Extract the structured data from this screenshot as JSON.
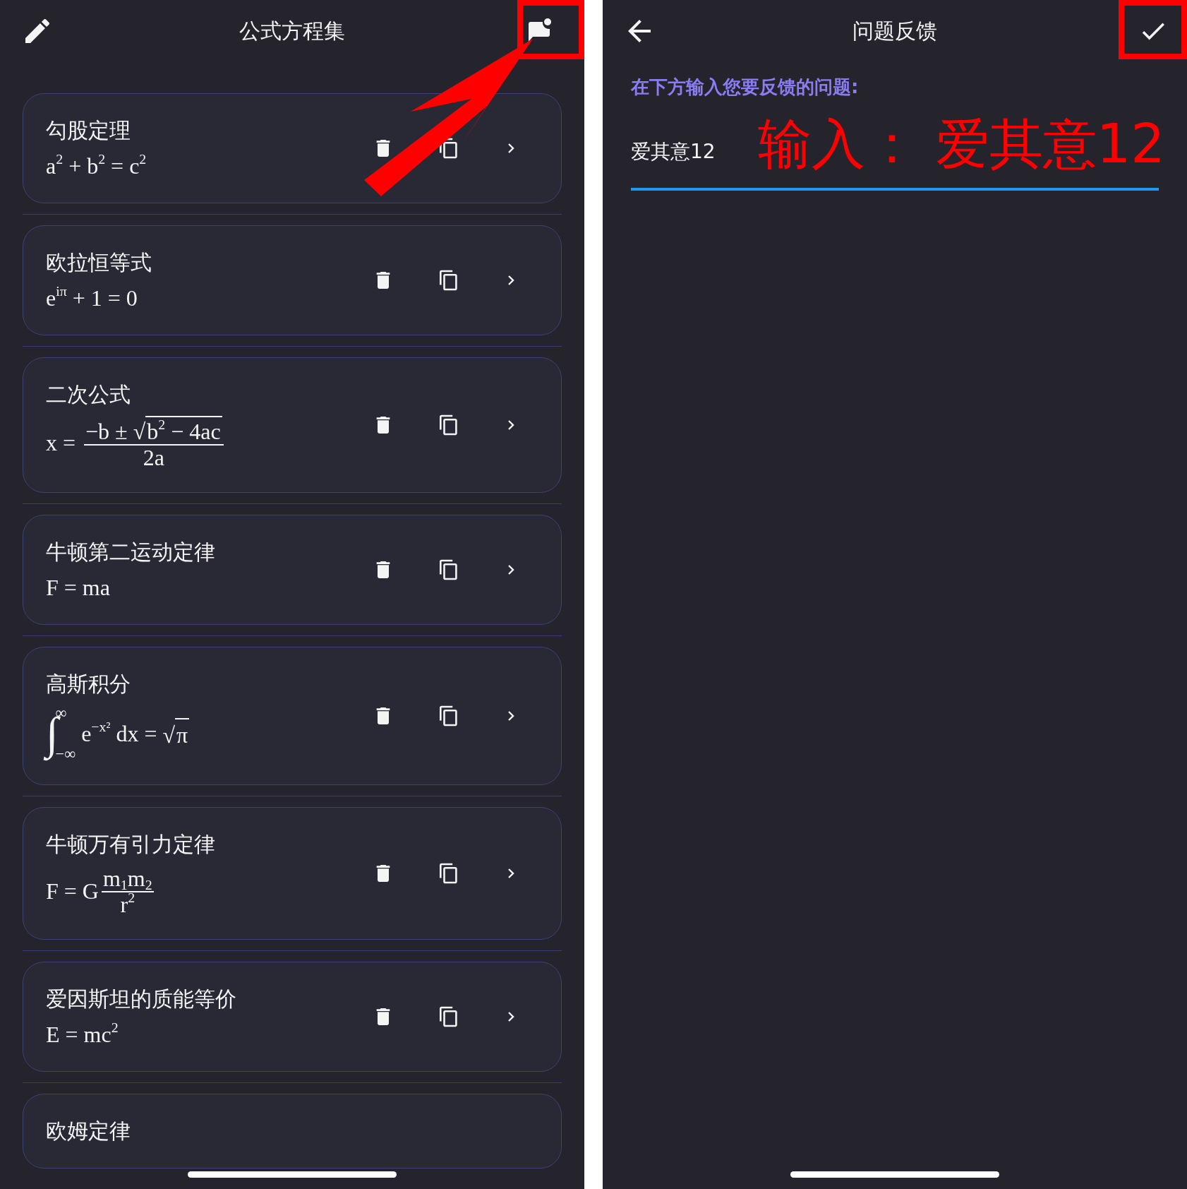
{
  "left_screen": {
    "title": "公式方程集",
    "formulas": [
      {
        "name": "勾股定理",
        "formula": [
          {
            "kind": "text",
            "text": "a$^{2}$ + b$^{2}$ = c$^{2}$"
          }
        ]
      },
      {
        "name": "欧拉恒等式",
        "formula": [
          {
            "kind": "text",
            "text": "e$^{iπ}$ + 1 = 0"
          }
        ]
      },
      {
        "name": "二次公式",
        "formula": [
          {
            "kind": "text",
            "text": "x = "
          },
          {
            "kind": "frac",
            "num": [
              {
                "kind": "text",
                "text": "−b ± "
              },
              {
                "kind": "sqrt",
                "sign": "√",
                "body": [
                  {
                    "kind": "text",
                    "text": "b$^{2}$ − 4ac"
                  }
                ]
              }
            ],
            "den": [
              {
                "kind": "text",
                "text": "2a"
              }
            ]
          }
        ]
      },
      {
        "name": "牛顿第二运动定律",
        "formula": [
          {
            "kind": "text",
            "text": "F = ma"
          }
        ]
      },
      {
        "name": "高斯积分",
        "formula": [
          {
            "kind": "integral",
            "sign": "∫",
            "upper": "∞",
            "lower": "−∞"
          },
          {
            "kind": "text",
            "text": " e$^{−x²}$ dx = "
          },
          {
            "kind": "sqrt",
            "sign": "√",
            "body": [
              {
                "kind": "text",
                "text": "π"
              }
            ]
          }
        ]
      },
      {
        "name": "牛顿万有引力定律",
        "formula": [
          {
            "kind": "text",
            "text": "F = G"
          },
          {
            "kind": "frac",
            "num": [
              {
                "kind": "text",
                "text": "m$_{1}$m$_{2}$"
              }
            ],
            "den": [
              {
                "kind": "text",
                "text": "r$^{2}$"
              }
            ]
          }
        ]
      },
      {
        "name": "爱因斯坦的质能等价",
        "formula": [
          {
            "kind": "text",
            "text": "E = mc$^{2}$"
          }
        ]
      },
      {
        "name": "欧姆定律"
      }
    ]
  },
  "right_screen": {
    "title": "问题反馈",
    "prompt": "在下方输入您要反馈的问题:",
    "input_value": "爱其意12",
    "annotation": "输入： 爱其意12"
  }
}
